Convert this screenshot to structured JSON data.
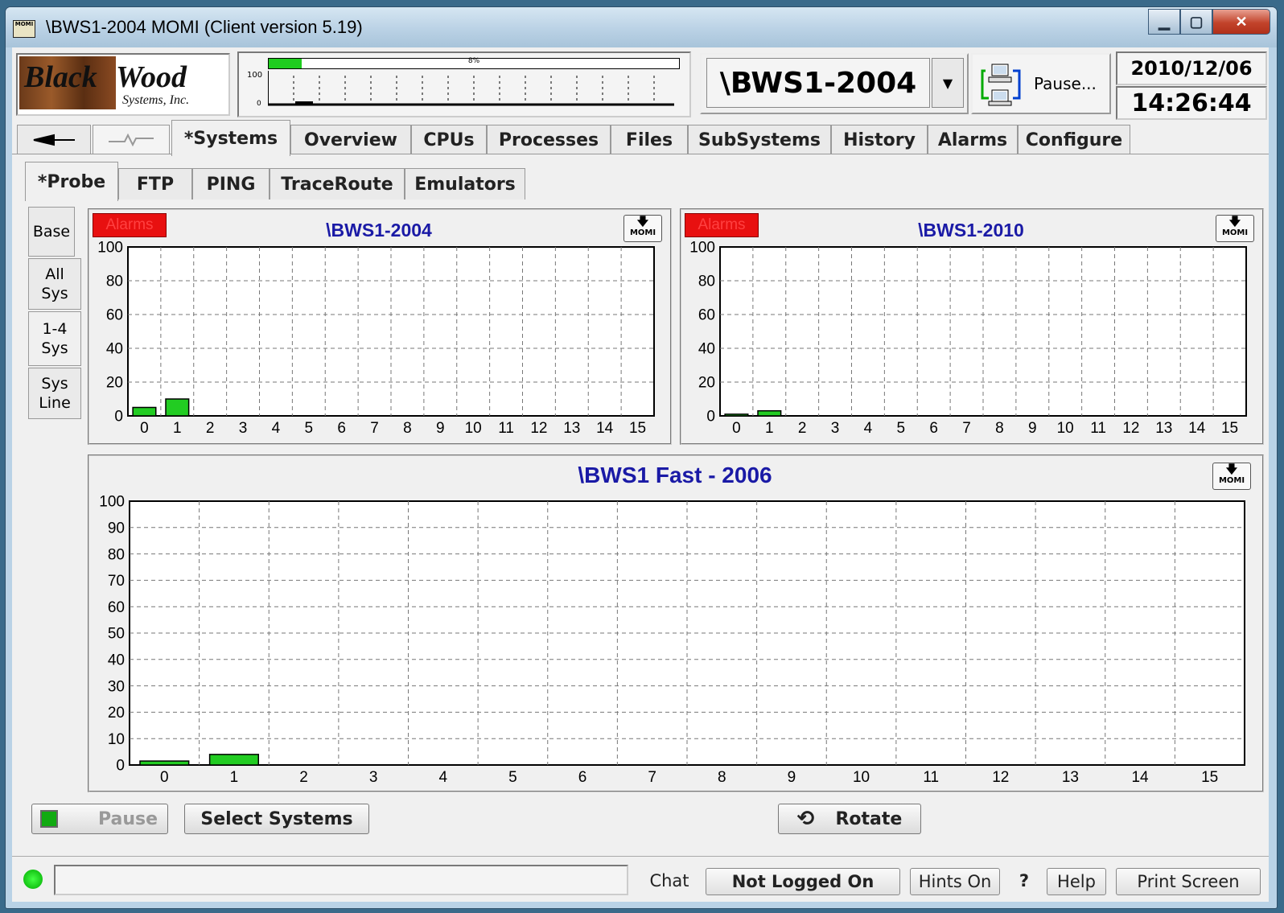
{
  "window": {
    "title": "\\BWS1-2004 MOMI (Client version 5.19)",
    "app_icon": "MOMI"
  },
  "logo": {
    "line1": "Black",
    "line2": "Wood",
    "line3": "Systems, Inc."
  },
  "perf": {
    "percent_label": "8%",
    "percent": 8,
    "axis_max": "100",
    "axis_min": "0"
  },
  "system": {
    "name": "\\BWS1-2004"
  },
  "pause_top": {
    "label": "Pause..."
  },
  "date": "2010/12/06",
  "time": "14:26:44",
  "main_tabs": [
    "*Systems",
    "Overview",
    "CPUs",
    "Processes",
    "Files",
    "SubSystems",
    "History",
    "Alarms",
    "Configure"
  ],
  "sub_tabs": [
    "*Probe",
    "FTP",
    "PING",
    "TraceRoute",
    "Emulators"
  ],
  "side_tabs": [
    "Base",
    "All Sys",
    "1-4 Sys",
    "Sys Line"
  ],
  "panels": [
    {
      "alarm": "Alarms",
      "title": "\\BWS1-2004",
      "momi": "MOMI"
    },
    {
      "alarm": "Alarms",
      "title": "\\BWS1-2010",
      "momi": "MOMI"
    },
    {
      "title": "\\BWS1 Fast - 2006",
      "momi": "MOMI"
    }
  ],
  "chart_data": [
    {
      "type": "bar",
      "title": "\\BWS1-2004",
      "x": [
        0,
        1,
        2,
        3,
        4,
        5,
        6,
        7,
        8,
        9,
        10,
        11,
        12,
        13,
        14,
        15
      ],
      "values": [
        5,
        10,
        0,
        0,
        0,
        0,
        0,
        0,
        0,
        0,
        0,
        0,
        0,
        0,
        0,
        0
      ],
      "ylim": [
        0,
        100
      ],
      "yticks": [
        0,
        20,
        40,
        60,
        80,
        100
      ],
      "bar_color": "#22cc22",
      "grid": true
    },
    {
      "type": "bar",
      "title": "\\BWS1-2010",
      "x": [
        0,
        1,
        2,
        3,
        4,
        5,
        6,
        7,
        8,
        9,
        10,
        11,
        12,
        13,
        14,
        15
      ],
      "values": [
        1,
        3,
        0,
        0,
        0,
        0,
        0,
        0,
        0,
        0,
        0,
        0,
        0,
        0,
        0,
        0
      ],
      "ylim": [
        0,
        100
      ],
      "yticks": [
        0,
        20,
        40,
        60,
        80,
        100
      ],
      "bar_color": "#22cc22",
      "grid": true
    },
    {
      "type": "bar",
      "title": "\\BWS1 Fast - 2006",
      "x": [
        0,
        1,
        2,
        3,
        4,
        5,
        6,
        7,
        8,
        9,
        10,
        11,
        12,
        13,
        14,
        15
      ],
      "values": [
        1.5,
        4,
        0,
        0,
        0,
        0,
        0,
        0,
        0,
        0,
        0,
        0,
        0,
        0,
        0,
        0
      ],
      "ylim": [
        0,
        100
      ],
      "yticks": [
        0,
        10,
        20,
        30,
        40,
        50,
        60,
        70,
        80,
        90,
        100
      ],
      "bar_color": "#22cc22",
      "grid": true
    }
  ],
  "bottom": {
    "pause": "Pause",
    "select_systems": "Select Systems",
    "rotate": "Rotate"
  },
  "status": {
    "chat": "Chat",
    "login": "Not Logged On",
    "hints": "Hints On",
    "question": "?",
    "help": "Help",
    "print": "Print Screen"
  }
}
